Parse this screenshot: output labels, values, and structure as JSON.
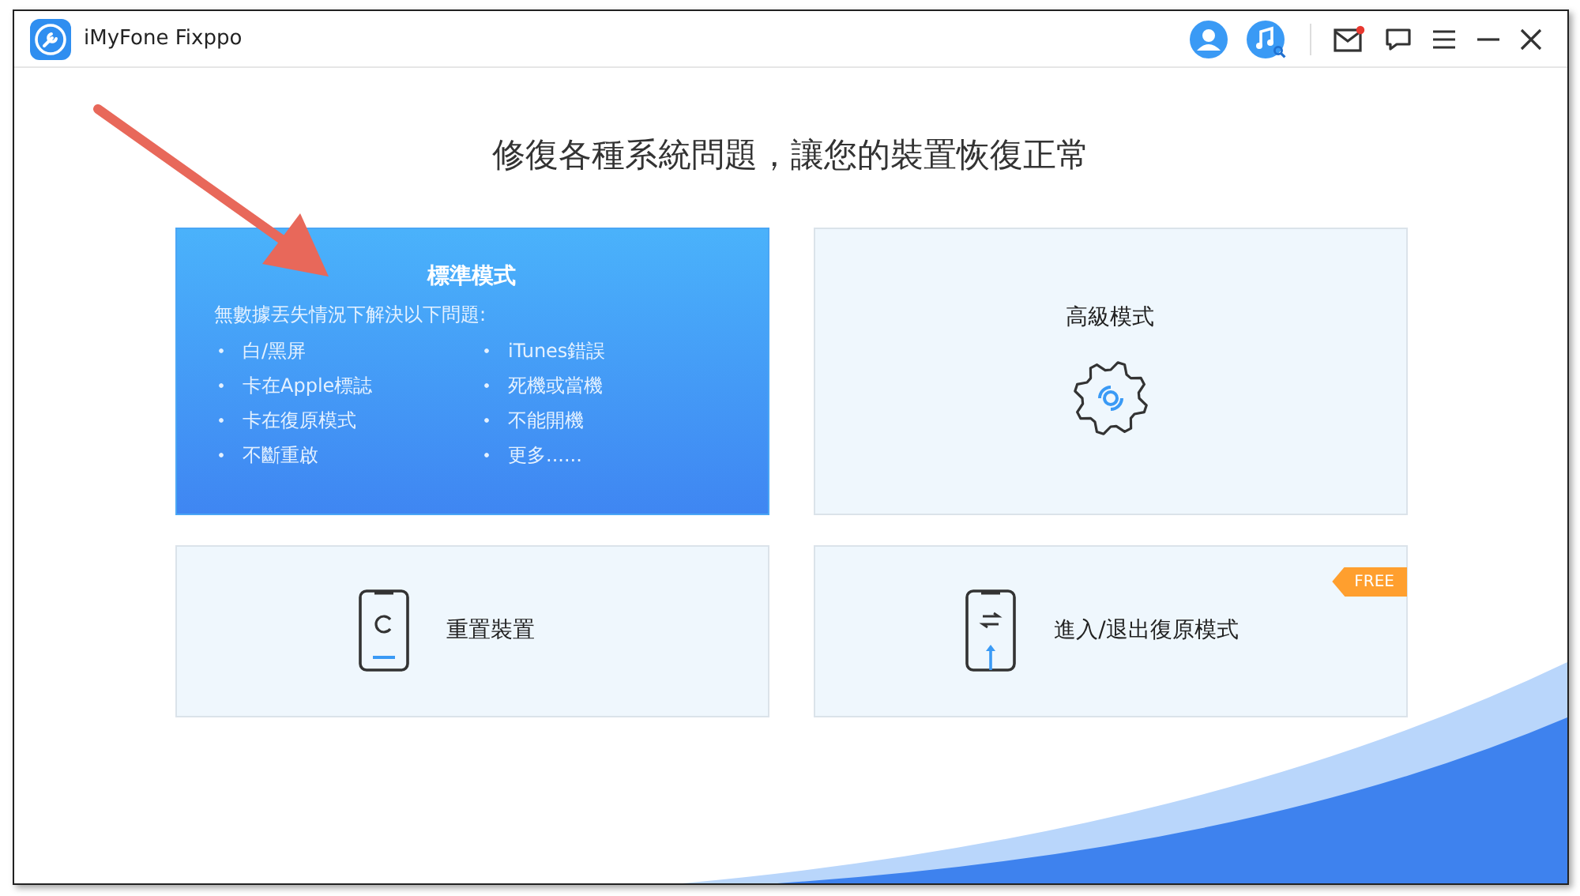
{
  "window": {
    "title": "iMyFone Fixppo",
    "mail_notification": true
  },
  "heading": "修復各種系統問題，讓您的裝置恢復正常",
  "modes": [
    {
      "kind": "detailed",
      "title": "標準模式",
      "selected": true,
      "subtitle": "無數據丟失情況下解決以下問題:",
      "issues": [
        "白/黑屏",
        "iTunes錯誤",
        "卡在Apple標誌",
        "死機或當機",
        "卡在復原模式",
        "不能開機",
        "不斷重啟",
        "更多......"
      ]
    },
    {
      "kind": "gear",
      "title": "高級模式",
      "selected": false
    },
    {
      "kind": "reset",
      "title": "重置裝置",
      "selected": false
    },
    {
      "kind": "recovery",
      "title": "進入/退出復原模式",
      "selected": false,
      "badge": "FREE"
    }
  ]
}
